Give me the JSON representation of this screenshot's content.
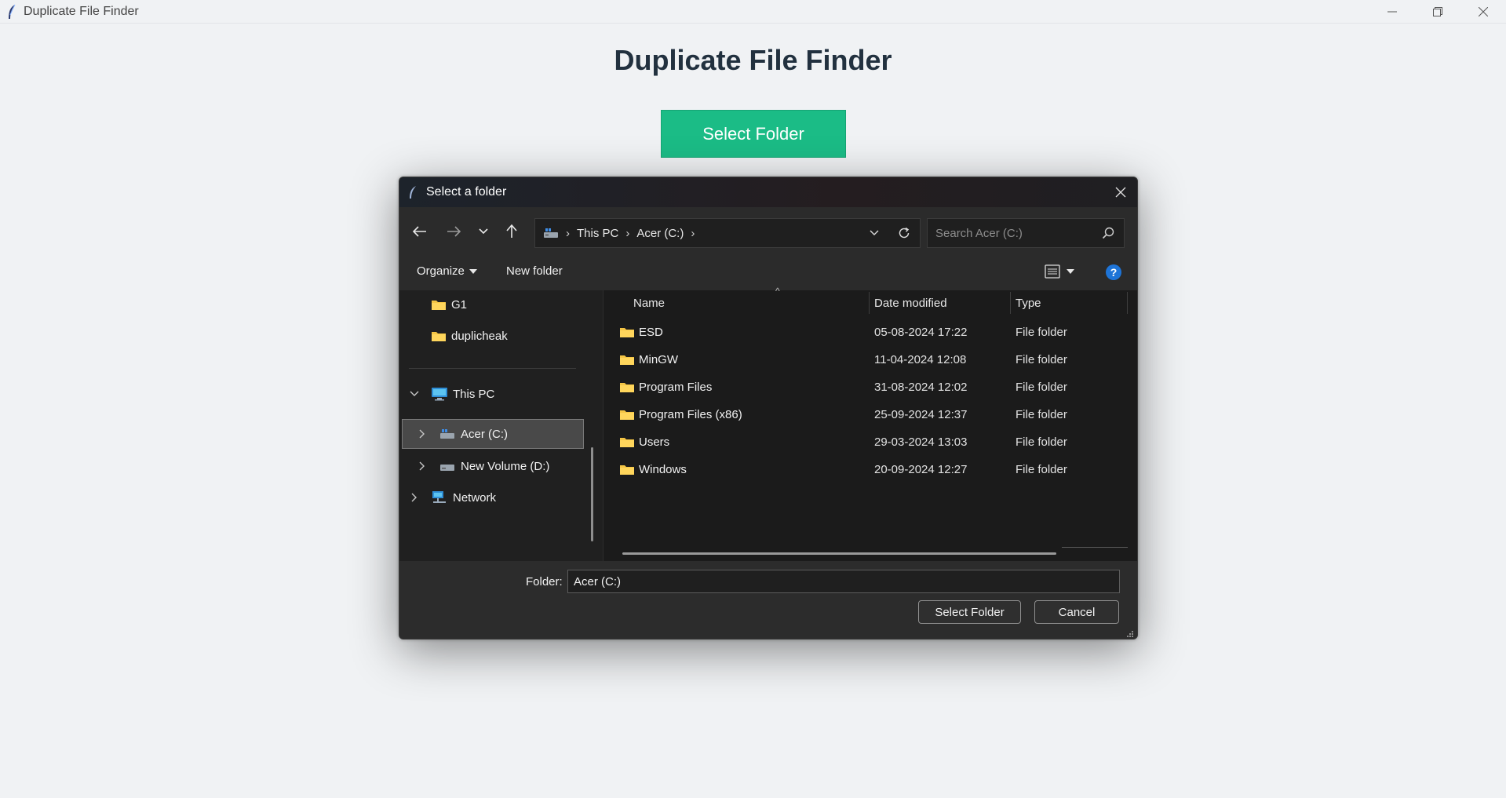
{
  "app": {
    "title": "Duplicate File Finder",
    "heading": "Duplicate File Finder",
    "select_folder_button": "Select Folder",
    "accent_color": "#1bbc86"
  },
  "dialog": {
    "title": "Select a folder",
    "breadcrumb": [
      "This PC",
      "Acer (C:)"
    ],
    "search_placeholder": "Search Acer (C:)",
    "toolbar": {
      "organize": "Organize",
      "new_folder": "New folder"
    },
    "tree": {
      "quick_items": [
        "G1",
        "duplicheak"
      ],
      "this_pc": "This PC",
      "drive_c": "Acer (C:)",
      "drive_d": "New Volume (D:)",
      "network": "Network",
      "selected": "Acer (C:)"
    },
    "columns": {
      "name": "Name",
      "date": "Date modified",
      "type": "Type"
    },
    "files": [
      {
        "name": "ESD",
        "date": "05-08-2024 17:22",
        "type": "File folder"
      },
      {
        "name": "MinGW",
        "date": "11-04-2024 12:08",
        "type": "File folder"
      },
      {
        "name": "Program Files",
        "date": "31-08-2024 12:02",
        "type": "File folder"
      },
      {
        "name": "Program Files (x86)",
        "date": "25-09-2024 12:37",
        "type": "File folder"
      },
      {
        "name": "Users",
        "date": "29-03-2024 13:03",
        "type": "File folder"
      },
      {
        "name": "Windows",
        "date": "20-09-2024 12:27",
        "type": "File folder"
      }
    ],
    "folder_label": "Folder:",
    "folder_value": "Acer (C:)",
    "select_button": "Select Folder",
    "cancel_button": "Cancel"
  }
}
